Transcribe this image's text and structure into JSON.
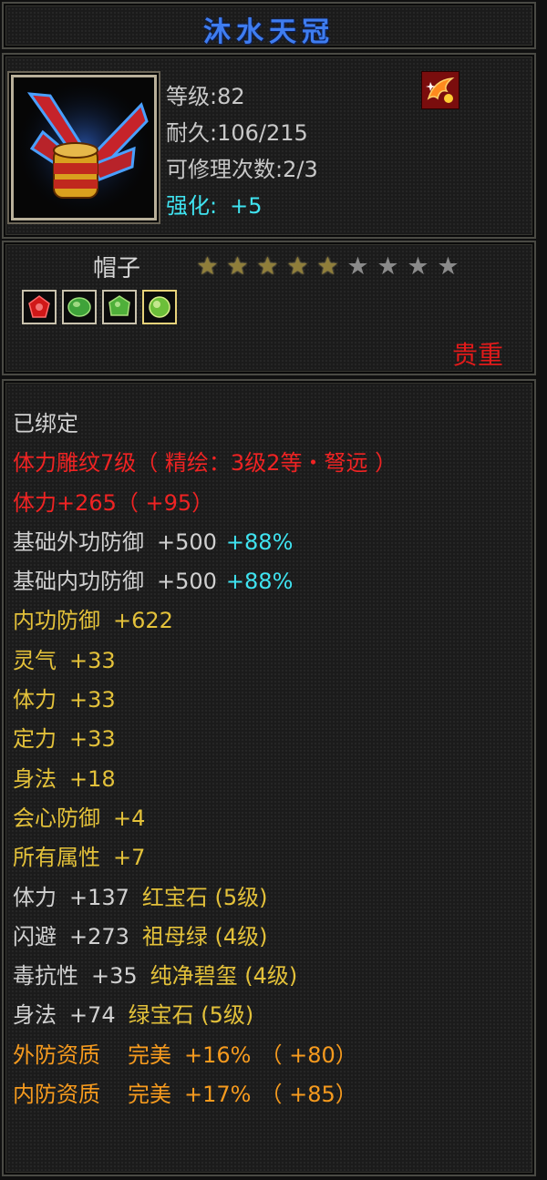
{
  "item": {
    "name": "沐水天冠",
    "level": "等级:82",
    "durability": "耐久:106/215",
    "repair_count": "可修理次数:2/3",
    "enhance_label": "强化:",
    "enhance_value": "+5",
    "type": "帽子",
    "stars_total": 9,
    "stars_filled": 5,
    "rarity": "贵重",
    "icon": "winged-crown-icon",
    "badge_icon": "phoenix-badge-icon",
    "gems": [
      {
        "icon": "red-gem-icon",
        "color": "#d01818"
      },
      {
        "icon": "green-gem-icon",
        "color": "#3fa33a"
      },
      {
        "icon": "green-gem-icon",
        "color": "#4fb03a"
      },
      {
        "icon": "green-gem-icon",
        "color": "#6cbf3a"
      }
    ]
  },
  "attributes": {
    "bound": "已绑定",
    "engrave_a": "体力雕纹7级",
    "engrave_b": "（ 精绘：3级2等・弩远 ）",
    "str_base": "体力+265",
    "str_bonus": "（ +95）",
    "ext_def_label": "基础外功防御",
    "ext_def_val": "+500",
    "ext_def_pct": "+88%",
    "int_def_label": "基础内功防御",
    "int_def_val": "+500",
    "int_def_pct": "+88%",
    "rows": [
      {
        "label": "内功防御",
        "value": "+622"
      },
      {
        "label": "灵气",
        "value": "+33"
      },
      {
        "label": "体力",
        "value": "+33"
      },
      {
        "label": "定力",
        "value": "+33"
      },
      {
        "label": "身法",
        "value": "+18"
      },
      {
        "label": "会心防御",
        "value": "+4"
      },
      {
        "label": "所有属性",
        "value": "+7"
      }
    ],
    "gem_rows": [
      {
        "label": "体力",
        "value": "+137",
        "gem": "红宝石 (5级)"
      },
      {
        "label": "闪避",
        "value": "+273",
        "gem": "祖母绿 (4级)"
      },
      {
        "label": "毒抗性",
        "value": "+35",
        "gem": "纯净碧玺 (4级)"
      },
      {
        "label": "身法",
        "value": "+74",
        "gem": "绿宝石 (5级)"
      }
    ],
    "quality_rows": [
      {
        "label": "外防资质",
        "grade": "完美",
        "value": "+16%",
        "bonus": "（ +80）"
      },
      {
        "label": "内防资质",
        "grade": "完美",
        "value": "+17%",
        "bonus": "（ +85）"
      }
    ]
  },
  "colors": {
    "title_blue": "#3f7df0",
    "red": "#ef2323",
    "cyan": "#3fe3f0",
    "yellow": "#e3c13a",
    "orange": "#f59a1e",
    "white": "#d0d0d0"
  }
}
